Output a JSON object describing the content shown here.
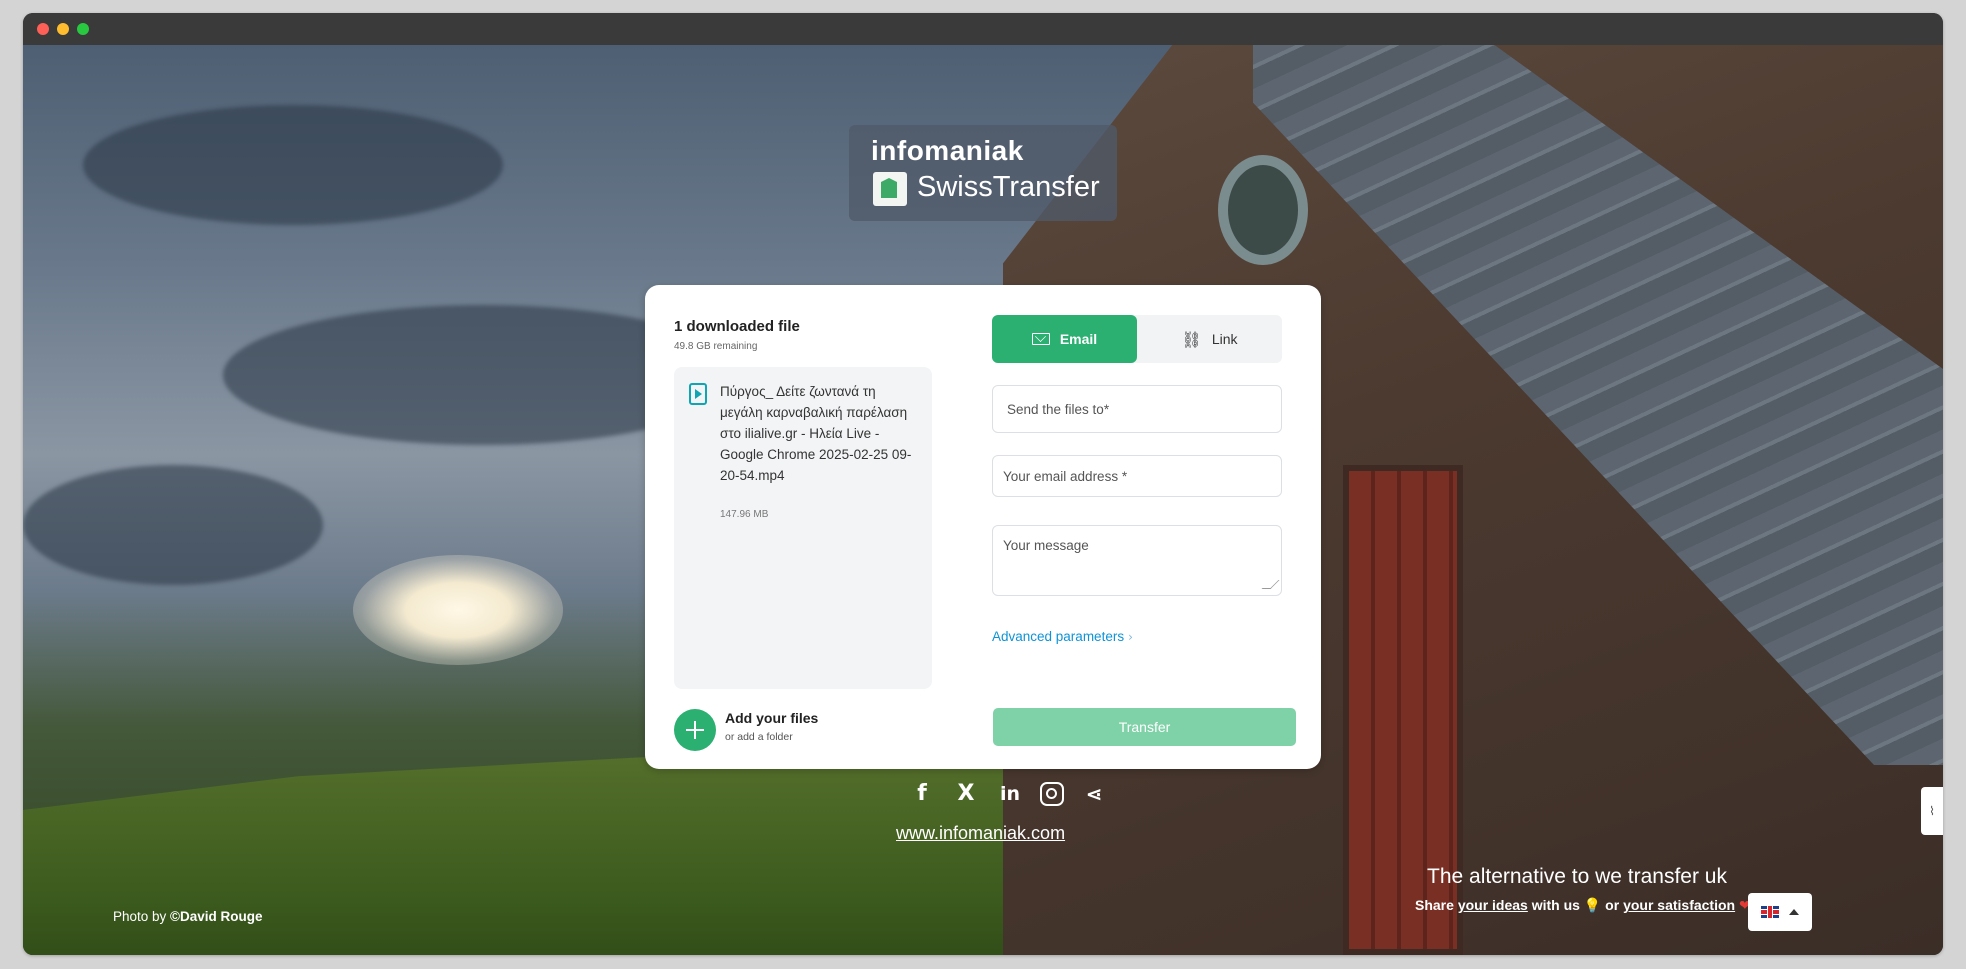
{
  "logo": {
    "brand": "infomaniak",
    "product": "SwissTransfer"
  },
  "files": {
    "title": "1 downloaded file",
    "remaining": "49.8 GB remaining",
    "items": [
      {
        "name": "Πύργος_ Δείτε ζωντανά τη μεγάλη καρναβαλική παρέλαση στο ilialive.gr - Ηλεία Live - Google Chrome 2025-02-25 09-20-54.mp4",
        "size": "147.96 MB"
      }
    ],
    "add_title": "Add your files",
    "add_sub": "or add a folder"
  },
  "tabs": {
    "email": "Email",
    "link": "Link"
  },
  "form": {
    "to_placeholder": "Send the files to*",
    "from_placeholder": "Your email address *",
    "message_placeholder": "Your message",
    "advanced": "Advanced parameters",
    "transfer": "Transfer"
  },
  "footer": {
    "website": "www.infomaniak.com",
    "photo_prefix": "Photo by ",
    "photo_author": "©David Rouge",
    "tagline": "The alternative to we transfer uk",
    "share_1": "Share ",
    "share_ideas": "your ideas",
    "share_2": " with us ",
    "share_or": " or ",
    "share_satisfaction": "your satisfaction"
  },
  "icons": {
    "social": [
      "facebook-icon",
      "x-icon",
      "linkedin-icon",
      "instagram-icon",
      "share-icon"
    ],
    "accent": "#2bb071",
    "link_color": "#0e93d6"
  }
}
